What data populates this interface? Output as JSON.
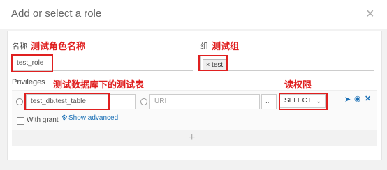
{
  "dialog": {
    "title": "Add or select a role",
    "close_glyph": "×"
  },
  "name_field": {
    "label": "名称",
    "value": "test_role",
    "annotation": "测试角色名称"
  },
  "group_field": {
    "label": "组",
    "annotation": "测试组",
    "tag_label": "test",
    "tag_remove_glyph": "×"
  },
  "privileges": {
    "label": "Privileges",
    "db_table_value": "test_db.test_table",
    "db_annotation": "测试数据库下的测试表",
    "uri_placeholder": "URI",
    "browse_label": "..",
    "access_value": "SELECT",
    "access_annotation": "读权限",
    "with_grant_label": "With grant",
    "show_advanced_label": "Show advanced",
    "add_glyph": "+"
  },
  "icons": [
    "check-circle-icon",
    "circle-radio-icon",
    "send-icon",
    "eye-icon",
    "close-icon",
    "gear-icon",
    "plus-icon",
    "chevron-down-icon"
  ],
  "colors": {
    "annotation": "#e02020",
    "link": "#1a6fb5"
  }
}
